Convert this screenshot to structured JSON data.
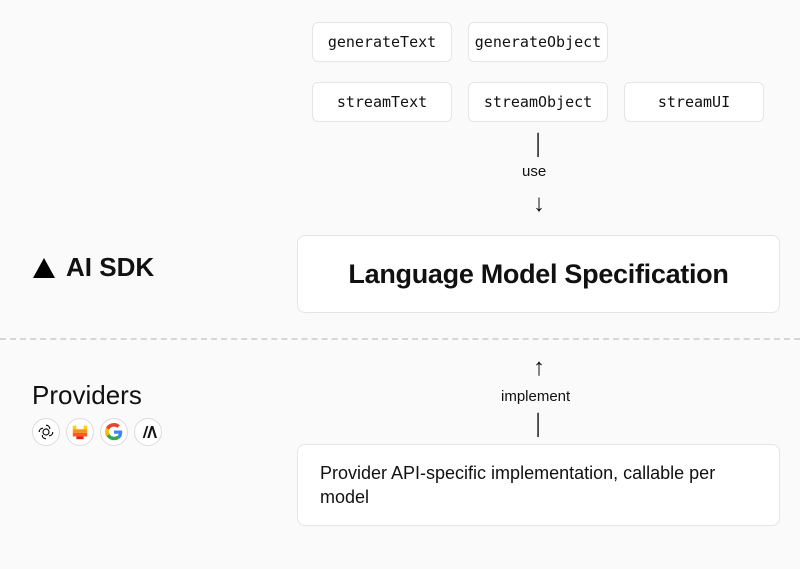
{
  "functions": {
    "row1": [
      "generateText",
      "generateObject"
    ],
    "row2": [
      "streamText",
      "streamObject",
      "streamUI"
    ]
  },
  "arrows": {
    "use_label": "use",
    "implement_label": "implement"
  },
  "spec_title": "Language Model Specification",
  "impl_title": "Provider API-specific implementation, callable per model",
  "left": {
    "sdk_label": "AI SDK",
    "providers_label": "Providers"
  },
  "providers": [
    "openai",
    "mistral",
    "google",
    "anthropic"
  ]
}
